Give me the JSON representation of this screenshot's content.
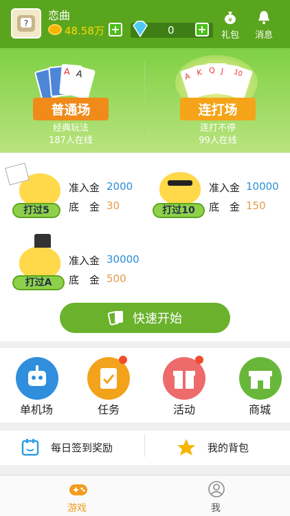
{
  "user": {
    "name": "恋曲",
    "coins": "48.58万",
    "gems": "0"
  },
  "header": {
    "gift_label": "礼包",
    "message_label": "消息"
  },
  "modes": [
    {
      "title": "普通场",
      "desc": "经典玩法",
      "online": "187人在线"
    },
    {
      "title": "连打场",
      "desc": "连打不停",
      "online": "99人在线"
    }
  ],
  "rooms": [
    {
      "tag": "打过5",
      "entry_label": "准入金",
      "entry": "2000",
      "base_label": "底　金",
      "base": "30"
    },
    {
      "tag": "打过10",
      "entry_label": "准入金",
      "entry": "10000",
      "base_label": "底　金",
      "base": "150"
    },
    {
      "tag": "打过A",
      "entry_label": "准入金",
      "entry": "30000",
      "base_label": "底　金",
      "base": "500"
    }
  ],
  "quick_start": "快速开始",
  "features": [
    {
      "label": "单机场",
      "icon": "robot-icon",
      "color": "#2f8fdd"
    },
    {
      "label": "任务",
      "icon": "task-clipboard-icon",
      "color": "#f3a21b"
    },
    {
      "label": "活动",
      "icon": "gift-icon",
      "color": "#ee6b6b"
    },
    {
      "label": "商城",
      "icon": "store-icon",
      "color": "#69b73a"
    }
  ],
  "checkin": "每日签到奖励",
  "bag": "我的背包",
  "tabs": [
    {
      "label": "游戏",
      "active": true
    },
    {
      "label": "我",
      "active": false
    }
  ],
  "colors": {
    "primary_green": "#5aa51e",
    "entry_blue": "#2a8ed8",
    "base_orange": "#e79a4a",
    "coin_yellow": "#ffd800"
  }
}
